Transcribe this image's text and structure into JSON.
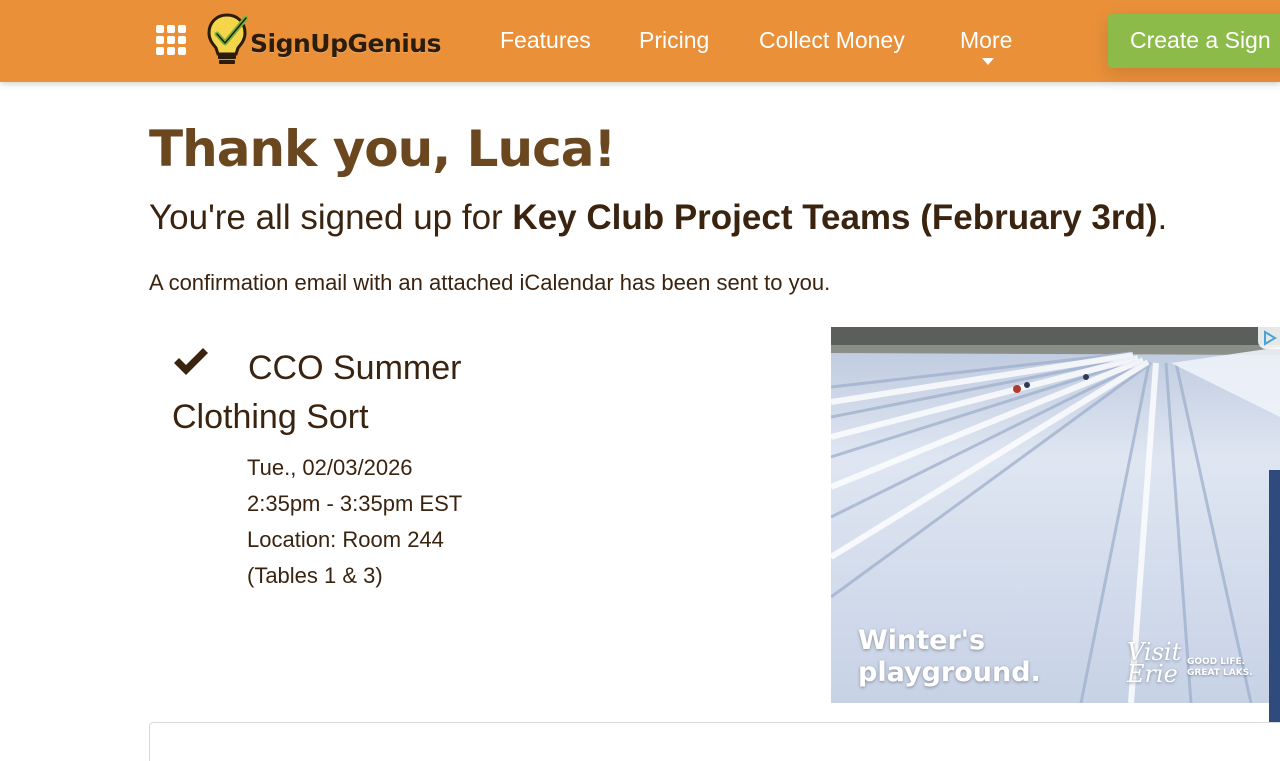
{
  "header": {
    "brand": "SignUpGenius",
    "nav": [
      "Features",
      "Pricing",
      "Collect Money",
      "More"
    ],
    "create_button": "Create a Sign",
    "bg_color": "#e99039",
    "button_color": "#8cbb4a",
    "apps_icon": "grid-icon",
    "more_icon": "caret-down-icon"
  },
  "main": {
    "title": "Thank you, Luca!",
    "subtitle_prefix": "You're all signed up for ",
    "subtitle_event": "Key Club Project Teams (February 3rd)",
    "subtitle_suffix": ".",
    "confirmation": "A confirmation email with an attached iCalendar has been sent to you.",
    "slot": {
      "icon": "checkmark-icon",
      "title": "CCO Summer Clothing Sort",
      "date": "Tue., 02/03/2026",
      "time": "2:35pm - 3:35pm EST",
      "location": "Location: Room 244",
      "note": "(Tables 1 & 3)"
    }
  },
  "ad": {
    "headline_line1": "Winter's",
    "headline_line2": "playground.",
    "brand_line1": "Visit",
    "brand_line2": "Erie",
    "tagline": "GOOD LIFE.\nGREAT LAKS."
  }
}
